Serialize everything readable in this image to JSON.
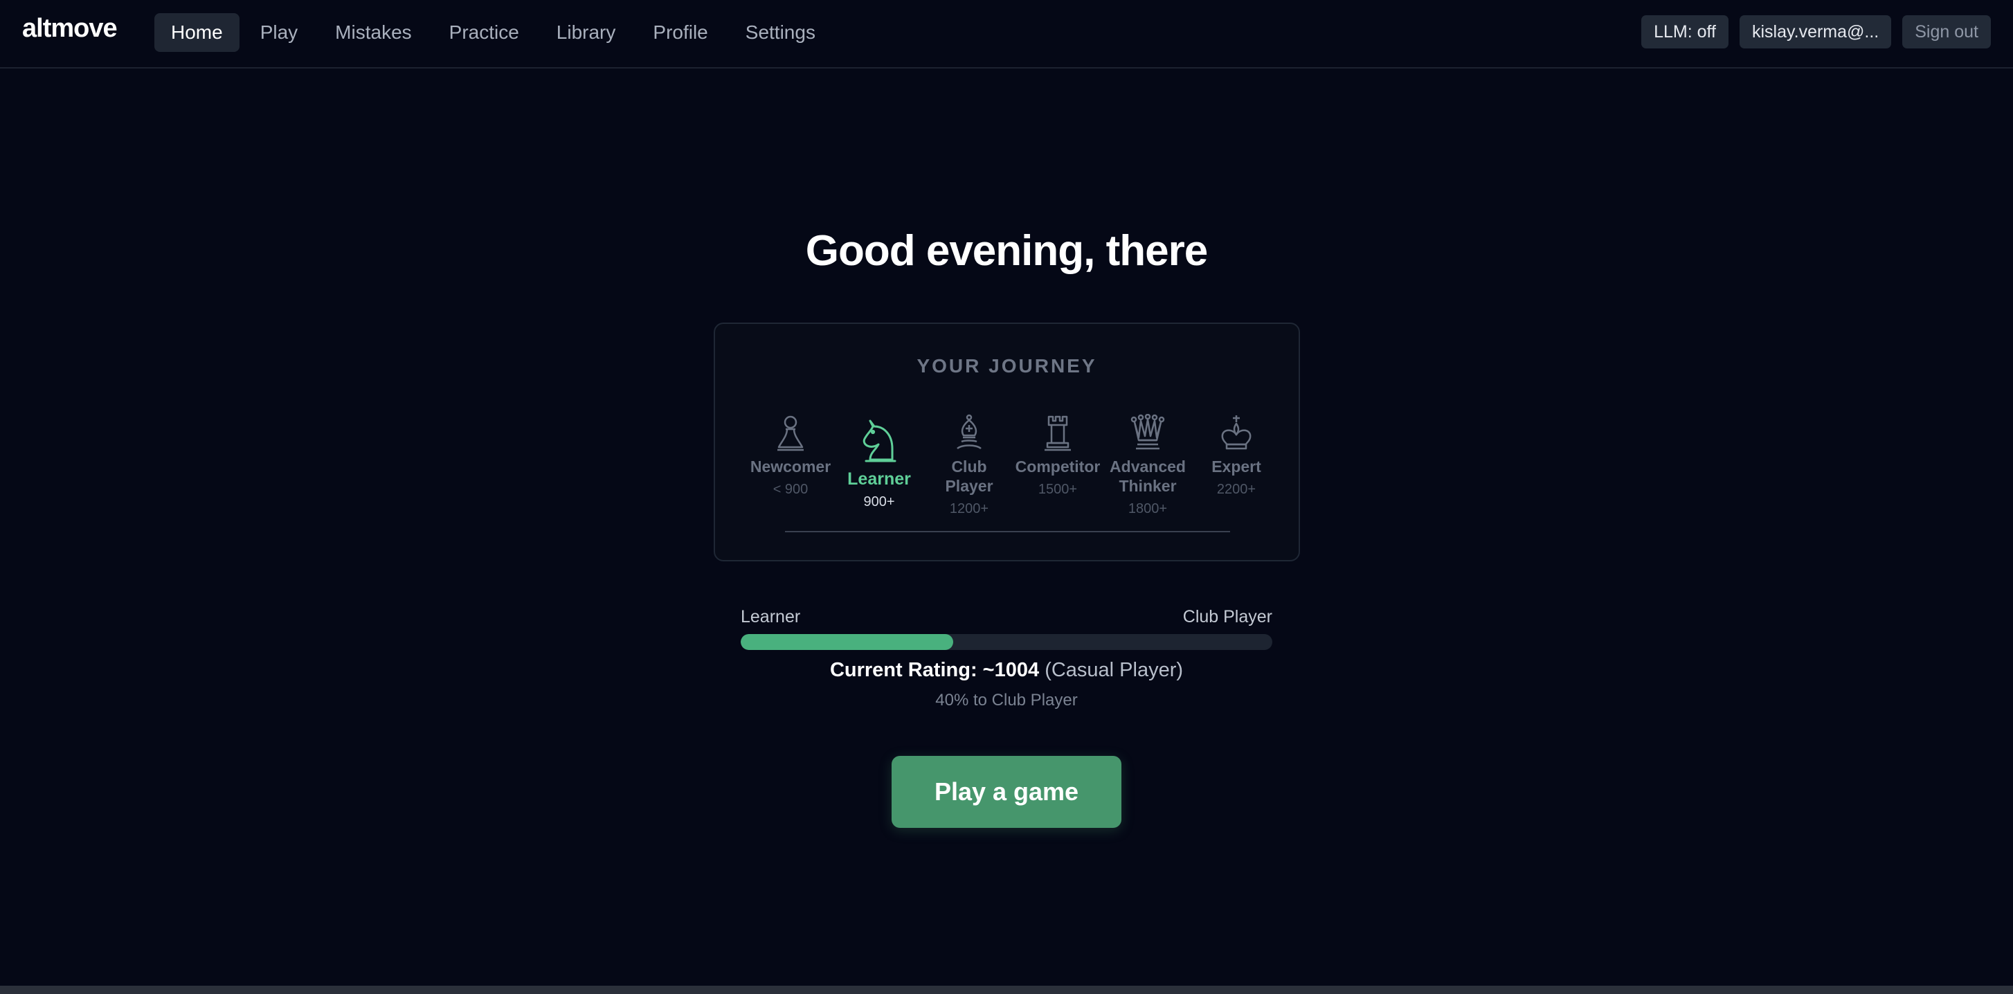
{
  "app": {
    "logo": "altmove"
  },
  "nav": {
    "items": [
      {
        "label": "Home",
        "active": true
      },
      {
        "label": "Play",
        "active": false
      },
      {
        "label": "Mistakes",
        "active": false
      },
      {
        "label": "Practice",
        "active": false
      },
      {
        "label": "Library",
        "active": false
      },
      {
        "label": "Profile",
        "active": false
      },
      {
        "label": "Settings",
        "active": false
      }
    ]
  },
  "header_actions": {
    "llm_status": "LLM: off",
    "user_email": "kislay.verma@...",
    "sign_out": "Sign out"
  },
  "main": {
    "greeting": "Good evening, there"
  },
  "journey": {
    "title": "YOUR JOURNEY",
    "stages": [
      {
        "name": "Newcomer",
        "requirement": "< 900",
        "icon": "pawn-icon",
        "current": false
      },
      {
        "name": "Learner",
        "requirement": "900+",
        "icon": "knight-icon",
        "current": true
      },
      {
        "name": "Club Player",
        "requirement": "1200+",
        "icon": "bishop-icon",
        "current": false
      },
      {
        "name": "Competitor",
        "requirement": "1500+",
        "icon": "rook-icon",
        "current": false
      },
      {
        "name": "Advanced Thinker",
        "requirement": "1800+",
        "icon": "queen-icon",
        "current": false
      },
      {
        "name": "Expert",
        "requirement": "2200+",
        "icon": "king-icon",
        "current": false
      }
    ]
  },
  "progress": {
    "from_label": "Learner",
    "to_label": "Club Player",
    "fraction": 0.4,
    "rating_label": "Current Rating: ~1004",
    "rating_category": "(Casual Player)",
    "note": "40% to Club Player"
  },
  "cta": {
    "play_label": "Play a game"
  },
  "colors": {
    "accent": "#5fcf98",
    "button": "#46966c",
    "progress_fill": "#49b17e",
    "background": "#050816"
  }
}
